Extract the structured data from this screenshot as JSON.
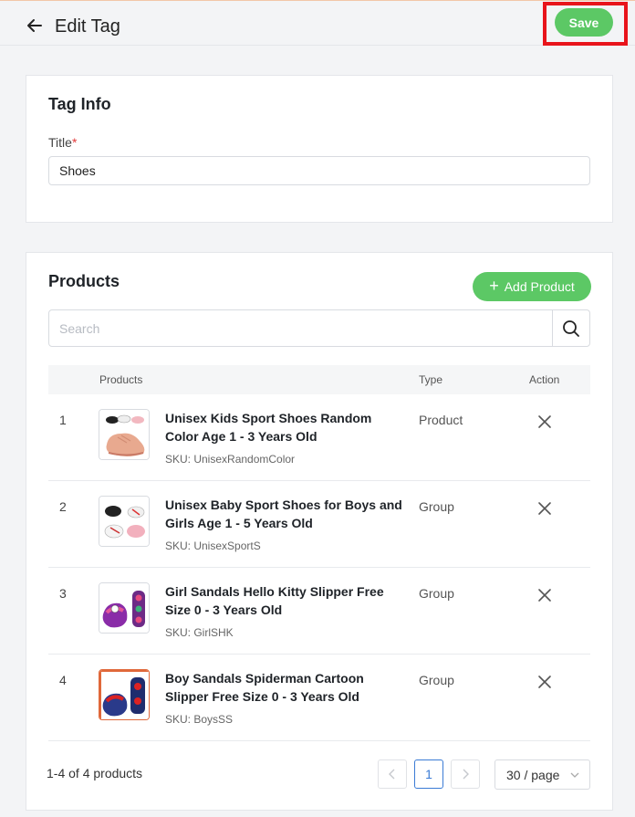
{
  "header": {
    "title": "Edit Tag",
    "save_label": "Save"
  },
  "tag_info": {
    "heading": "Tag Info",
    "title_label": "Title",
    "required_mark": "*",
    "title_value": "Shoes"
  },
  "products": {
    "heading": "Products",
    "add_label": "Add Product",
    "search_placeholder": "Search",
    "columns": {
      "products": "Products",
      "type": "Type",
      "action": "Action"
    },
    "rows": [
      {
        "index": "1",
        "name": "Unisex Kids Sport Shoes Random Color Age 1 - 3 Years Old",
        "sku": "SKU: UnisexRandomColor",
        "type": "Product",
        "thumb": "shoes-pink-icon"
      },
      {
        "index": "2",
        "name": "Unisex Baby Sport Shoes for Boys and Girls Age 1 - 5 Years Old",
        "sku": "SKU: UnisexSportS",
        "type": "Group",
        "thumb": "shoes-set-icon"
      },
      {
        "index": "3",
        "name": "Girl Sandals Hello Kitty Slipper Free Size 0 - 3 Years Old",
        "sku": "SKU: GirlSHK",
        "type": "Group",
        "thumb": "sandals-purple-icon"
      },
      {
        "index": "4",
        "name": "Boy Sandals Spiderman Cartoon Slipper Free Size 0 - 3 Years Old",
        "sku": "SKU: BoysSS",
        "type": "Group",
        "thumb": "sandals-red-icon"
      }
    ],
    "summary": "1-4 of 4 products",
    "current_page": "1",
    "per_page": "30 / page"
  },
  "colors": {
    "accent_green": "#5cc865",
    "highlight_red": "#e8141b",
    "page_blue": "#3a7bd5"
  }
}
